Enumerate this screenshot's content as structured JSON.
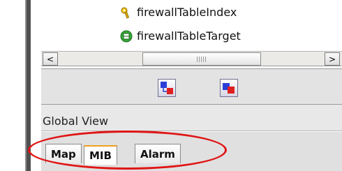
{
  "tree": {
    "items": [
      {
        "label": "firewallTableIndex",
        "icon": "key-icon"
      },
      {
        "label": "firewallTableTarget",
        "icon": "table-target-icon"
      }
    ]
  },
  "scrollbar": {
    "left_arrow": "<",
    "right_arrow": ">"
  },
  "global_view": {
    "label": "Global View"
  },
  "tabs": [
    {
      "label": "Map"
    },
    {
      "label": "MIB",
      "selected": true
    },
    {
      "label": "Alarm"
    }
  ],
  "colors": {
    "highlight_oval": "#e01515",
    "selected_tab_accent": "#f0a020"
  }
}
